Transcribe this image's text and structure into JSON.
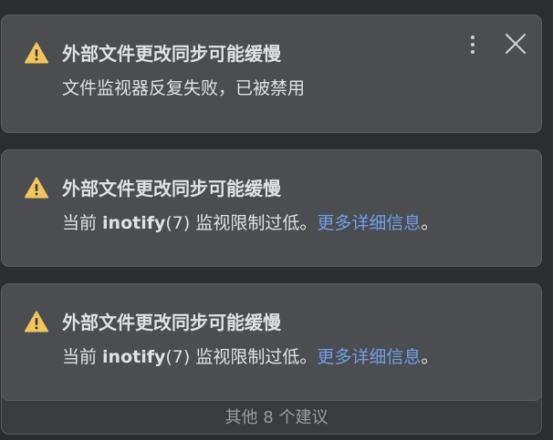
{
  "notifications": [
    {
      "title": "外部文件更改同步可能缓慢",
      "message": "文件监视器反复失败，已被禁用",
      "icon": "warning-icon",
      "show_controls": true
    },
    {
      "title": "外部文件更改同步可能缓慢",
      "message_prefix": "当前 ",
      "message_code": "inotify",
      "message_middle": "(7) 监视限制过低。",
      "link_text": "更多详细信息",
      "message_suffix": "。",
      "icon": "warning-icon"
    },
    {
      "title": "外部文件更改同步可能缓慢",
      "message_prefix": "当前 ",
      "message_code": "inotify",
      "message_middle": "(7) 监视限制过低。",
      "link_text": "更多详细信息",
      "message_suffix": "。",
      "icon": "warning-icon"
    }
  ],
  "controls": {
    "more_icon": "more-vertical-icon",
    "close_icon": "close-icon"
  },
  "footer": {
    "label": "其他 8 个建议"
  },
  "colors": {
    "background": "#2b2d30",
    "card": "#4c4d50",
    "warning": "#f2c55c",
    "link": "#6f9fe8"
  }
}
